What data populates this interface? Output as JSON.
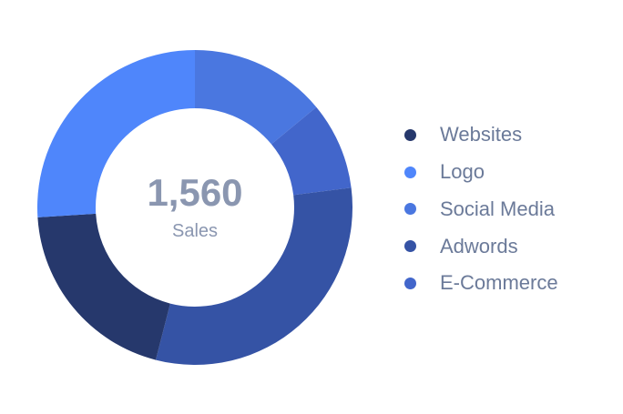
{
  "chart_data": {
    "type": "pie",
    "donut": true,
    "center": {
      "value": "1,560",
      "label": "Sales"
    },
    "categories": [
      "Websites",
      "Logo",
      "Social Media",
      "Adwords",
      "E-Commerce"
    ],
    "series": [
      {
        "values": [
          20,
          26,
          14,
          31,
          9
        ]
      }
    ],
    "slice_order_clockwise_from_top": [
      "Social Media",
      "E-Commerce",
      "Adwords",
      "Websites",
      "Logo"
    ],
    "colors": {
      "Websites": "#26386c",
      "Logo": "#4f86fb",
      "Social Media": "#4a77e0",
      "Adwords": "#3553a5",
      "E-Commerce": "#4266cb"
    },
    "legend_position": "right",
    "grid": false
  }
}
